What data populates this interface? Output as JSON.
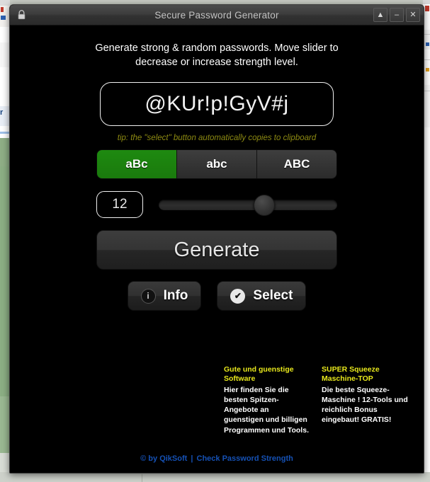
{
  "window": {
    "title": "Secure Password Generator",
    "icon": "padlock-icon",
    "controls": {
      "maximize": "▲",
      "minimize": "–",
      "close": "✕"
    }
  },
  "main": {
    "intro": "Generate strong & random passwords. Move slider to decrease or increase strength level.",
    "password": "@KUr!p!GyV#j",
    "tip": "tip: the \"select\" button automatically copies to clipboard",
    "case_options": [
      {
        "label": "aBc",
        "active": true
      },
      {
        "label": "abc",
        "active": false
      },
      {
        "label": "ABC",
        "active": false
      }
    ],
    "length": {
      "value": "12",
      "slider_percent": 60
    },
    "generate_label": "Generate",
    "actions": [
      {
        "label": "Info",
        "icon": "info-icon",
        "glyph": "i",
        "filled": false
      },
      {
        "label": "Select",
        "icon": "check-icon",
        "glyph": "✔",
        "filled": true
      }
    ]
  },
  "ads": [
    {
      "title": "Gute und guenstige Software",
      "body": "Hier finden Sie die besten Spitzen-Angebote an guenstigen und billigen Programmen und Tools."
    },
    {
      "title": "SUPER Squeeze Maschine-TOP",
      "body": "Die beste Squeeze-Maschine ! 12-Tools und reichlich Bonus eingebaut! GRATIS!"
    }
  ],
  "footer": {
    "copyright": "© by QikSoft",
    "separator": "|",
    "link": "Check Password Strength"
  },
  "colors": {
    "accent_green": "#1a7a0d",
    "tip_olive": "#8e8b12",
    "ad_yellow": "#e8e81c",
    "footer_blue": "#1551b5",
    "window_black": "#000000"
  }
}
